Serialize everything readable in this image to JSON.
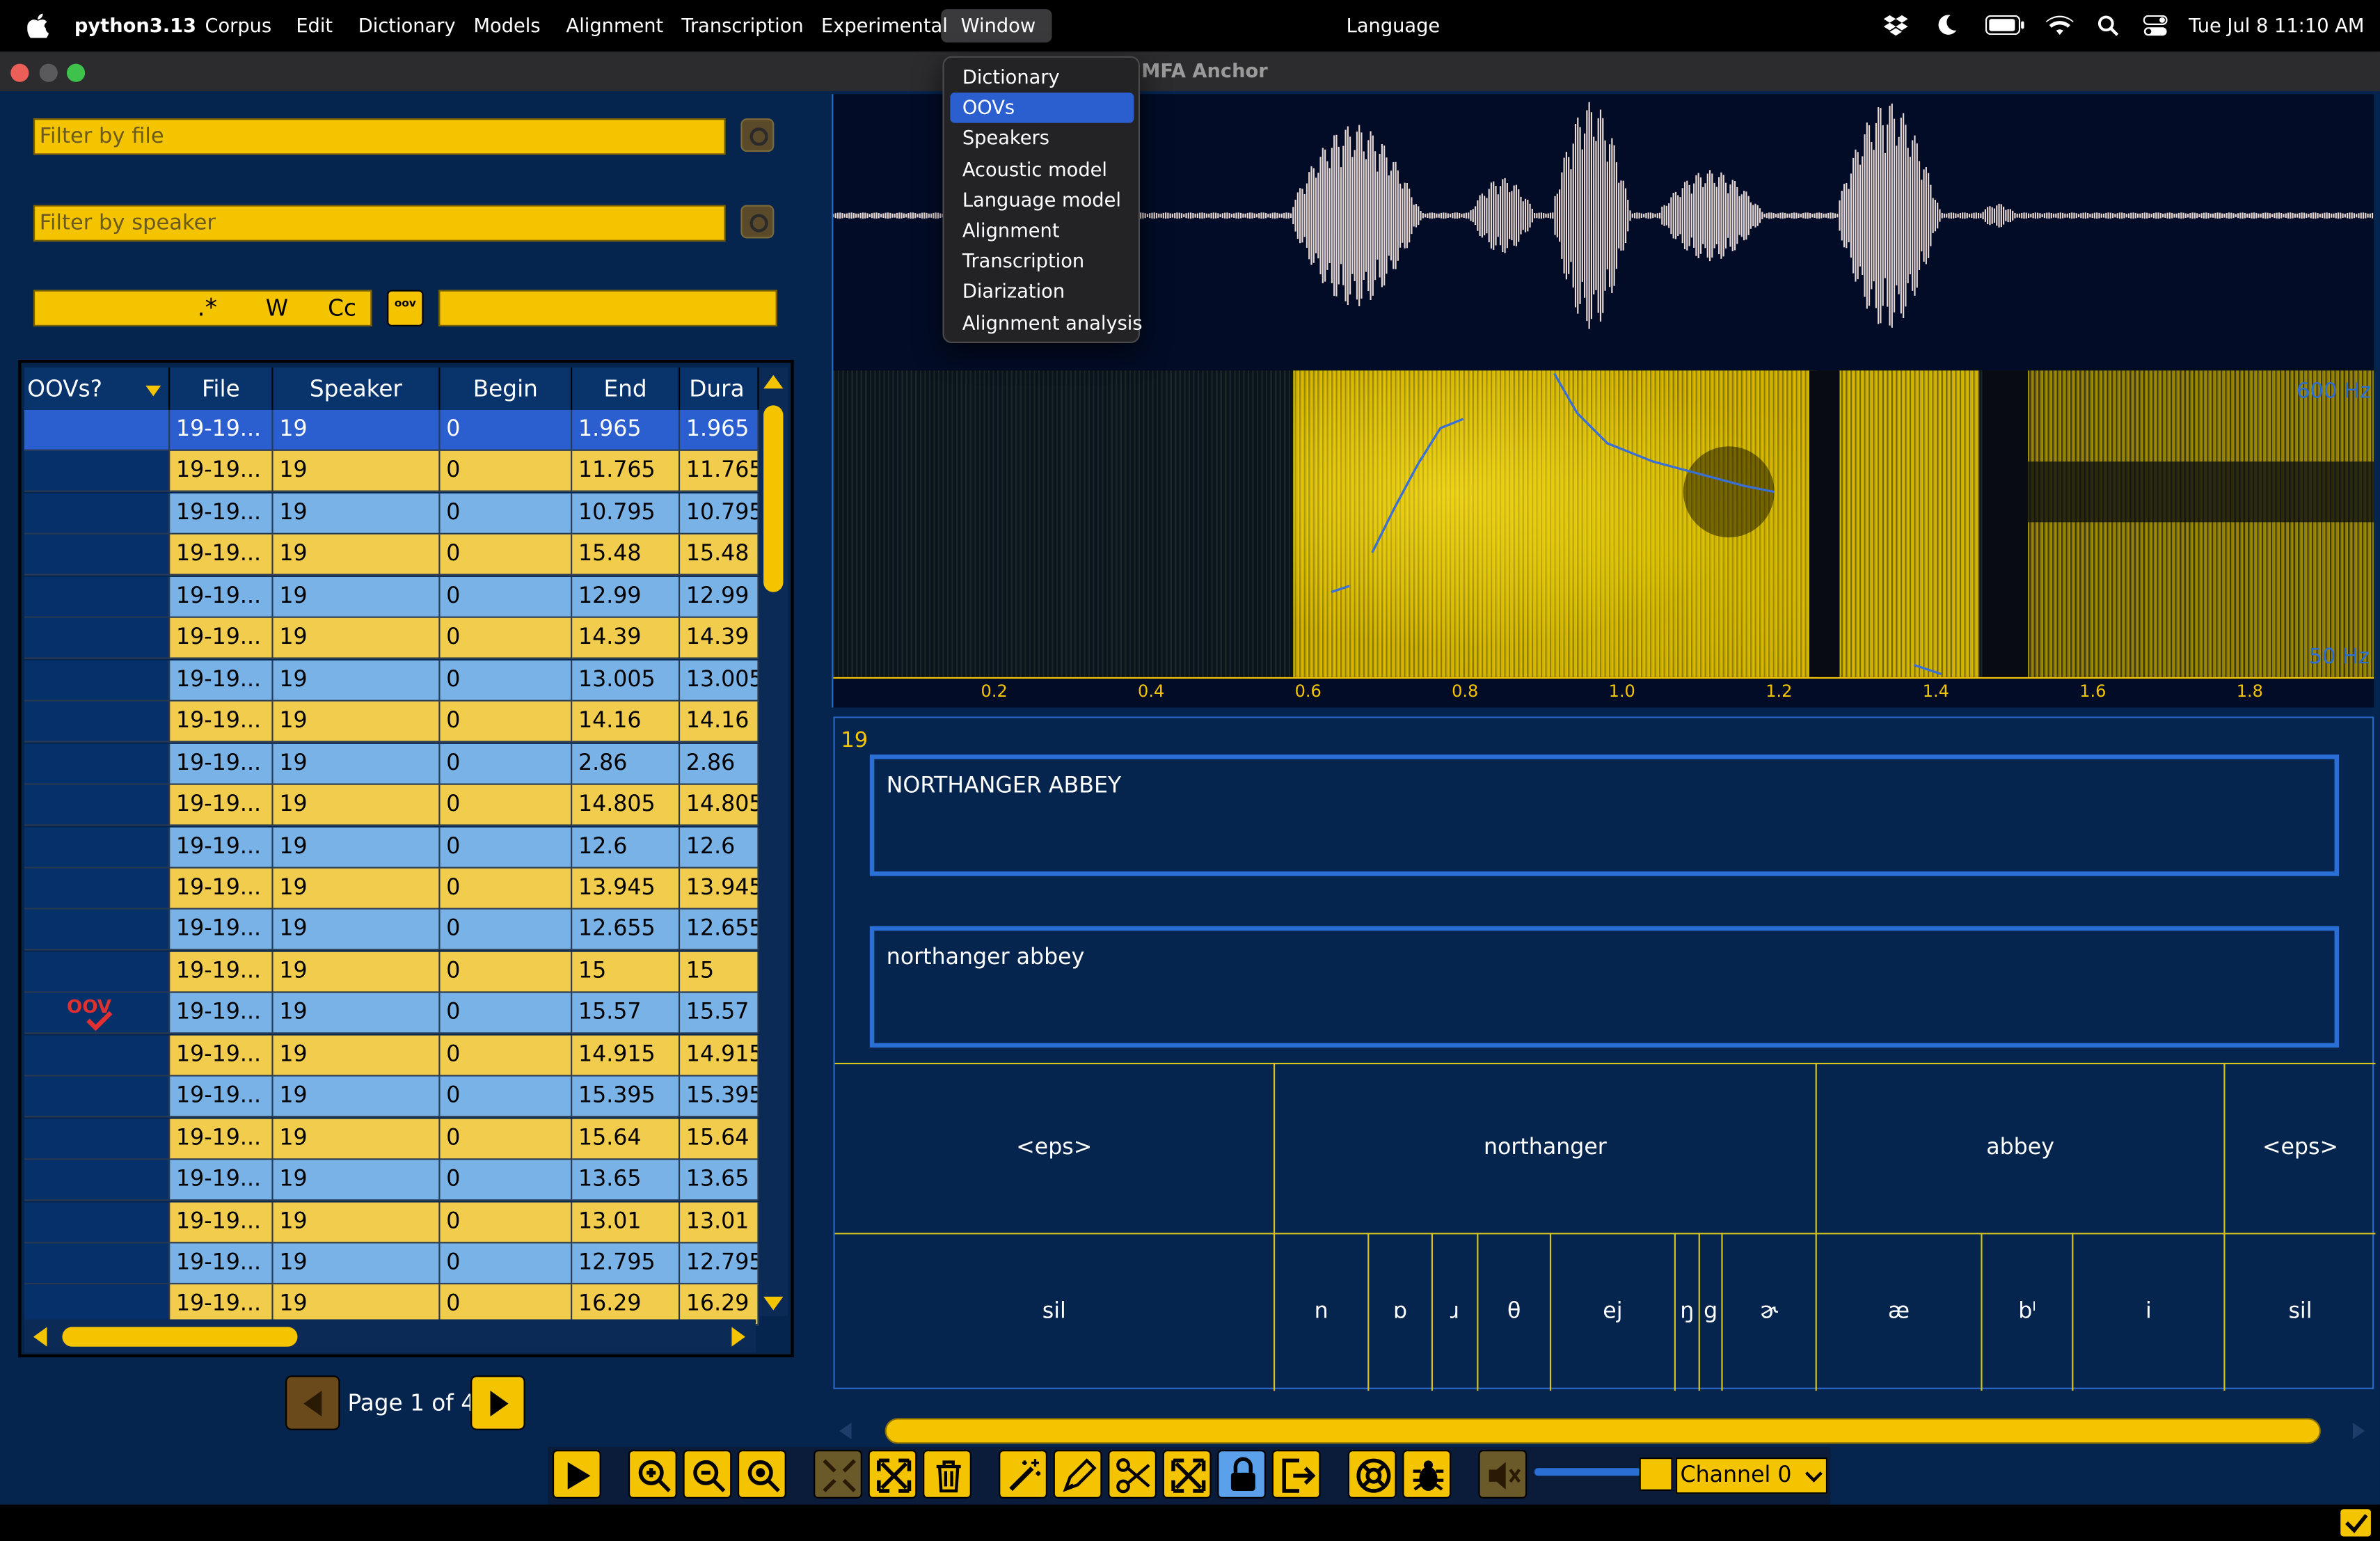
{
  "menubar": {
    "app": "python3.13",
    "menus": [
      "Corpus",
      "Edit",
      "Dictionary",
      "Models",
      "Alignment",
      "Transcription",
      "Experimental",
      "Window"
    ],
    "center_title": "Language",
    "clock": "Tue Jul 8  11:10 AM"
  },
  "window": {
    "title": "MFA Anchor"
  },
  "window_menu": {
    "items": [
      "Dictionary",
      "OOVs",
      "Speakers",
      "Acoustic model",
      "Language model",
      "Alignment",
      "Transcription",
      "Diarization",
      "Alignment analysis"
    ],
    "selected": "OOVs"
  },
  "filters": {
    "file_placeholder": "Filter by file",
    "speaker_placeholder": "Filter by speaker",
    "regex_label": ".*",
    "word_label": "W",
    "case_label": "Cc",
    "oov_toggle": "oov"
  },
  "table": {
    "columns": [
      "OOVs?",
      "File",
      "Speaker",
      "Begin",
      "End",
      "Dura"
    ],
    "rows": [
      {
        "file": "19-19...",
        "speaker": "19",
        "begin": "0",
        "end": "1.965",
        "dur": "1.965",
        "oov": false,
        "selected": true
      },
      {
        "file": "19-19...",
        "speaker": "19",
        "begin": "0",
        "end": "11.765",
        "dur": "11.765",
        "oov": false
      },
      {
        "file": "19-19...",
        "speaker": "19",
        "begin": "0",
        "end": "10.795",
        "dur": "10.795",
        "oov": false
      },
      {
        "file": "19-19...",
        "speaker": "19",
        "begin": "0",
        "end": "15.48",
        "dur": "15.48",
        "oov": false
      },
      {
        "file": "19-19...",
        "speaker": "19",
        "begin": "0",
        "end": "12.99",
        "dur": "12.99",
        "oov": false
      },
      {
        "file": "19-19...",
        "speaker": "19",
        "begin": "0",
        "end": "14.39",
        "dur": "14.39",
        "oov": false
      },
      {
        "file": "19-19...",
        "speaker": "19",
        "begin": "0",
        "end": "13.005",
        "dur": "13.005",
        "oov": false
      },
      {
        "file": "19-19...",
        "speaker": "19",
        "begin": "0",
        "end": "14.16",
        "dur": "14.16",
        "oov": false
      },
      {
        "file": "19-19...",
        "speaker": "19",
        "begin": "0",
        "end": "2.86",
        "dur": "2.86",
        "oov": false
      },
      {
        "file": "19-19...",
        "speaker": "19",
        "begin": "0",
        "end": "14.805",
        "dur": "14.805",
        "oov": false
      },
      {
        "file": "19-19...",
        "speaker": "19",
        "begin": "0",
        "end": "12.6",
        "dur": "12.6",
        "oov": false
      },
      {
        "file": "19-19...",
        "speaker": "19",
        "begin": "0",
        "end": "13.945",
        "dur": "13.945",
        "oov": false
      },
      {
        "file": "19-19...",
        "speaker": "19",
        "begin": "0",
        "end": "12.655",
        "dur": "12.655",
        "oov": false
      },
      {
        "file": "19-19...",
        "speaker": "19",
        "begin": "0",
        "end": "15",
        "dur": "15",
        "oov": false
      },
      {
        "file": "19-19...",
        "speaker": "19",
        "begin": "0",
        "end": "15.57",
        "dur": "15.57",
        "oov": true
      },
      {
        "file": "19-19...",
        "speaker": "19",
        "begin": "0",
        "end": "14.915",
        "dur": "14.915",
        "oov": false
      },
      {
        "file": "19-19...",
        "speaker": "19",
        "begin": "0",
        "end": "15.395",
        "dur": "15.395",
        "oov": false
      },
      {
        "file": "19-19...",
        "speaker": "19",
        "begin": "0",
        "end": "15.64",
        "dur": "15.64",
        "oov": false
      },
      {
        "file": "19-19...",
        "speaker": "19",
        "begin": "0",
        "end": "13.65",
        "dur": "13.65",
        "oov": false
      },
      {
        "file": "19-19...",
        "speaker": "19",
        "begin": "0",
        "end": "13.01",
        "dur": "13.01",
        "oov": false
      },
      {
        "file": "19-19...",
        "speaker": "19",
        "begin": "0",
        "end": "12.795",
        "dur": "12.795",
        "oov": false
      },
      {
        "file": "19-19...",
        "speaker": "19",
        "begin": "0",
        "end": "16.29",
        "dur": "16.29",
        "oov": false
      }
    ]
  },
  "pagination": {
    "label": "Page 1 of 4"
  },
  "spectrogram": {
    "freq_high": "600 Hz",
    "freq_low": "50 Hz"
  },
  "timeline": {
    "ticks": [
      "0.2",
      "0.4",
      "0.6",
      "0.8",
      "1.0",
      "1.2",
      "1.4",
      "1.6",
      "1.8"
    ]
  },
  "utterance": {
    "speaker": "19",
    "text": "NORTHANGER ABBEY",
    "normalized": "northanger abbey"
  },
  "words": [
    "<eps>",
    "northanger",
    "abbey",
    "<eps>"
  ],
  "phones": [
    "sil",
    "n",
    "ɒ",
    "ɹ",
    "θ",
    "ej",
    "ŋ",
    "g",
    "ɚ",
    "æ",
    "bˡ",
    "i",
    "sil"
  ],
  "toolbar": {
    "channel": "Channel 0"
  },
  "colors": {
    "accent": "#f5c400",
    "row_blue": "#79b2e6",
    "row_yellow": "#f2cd4d",
    "selection": "#2b5fcf",
    "panel": "#05254f"
  }
}
